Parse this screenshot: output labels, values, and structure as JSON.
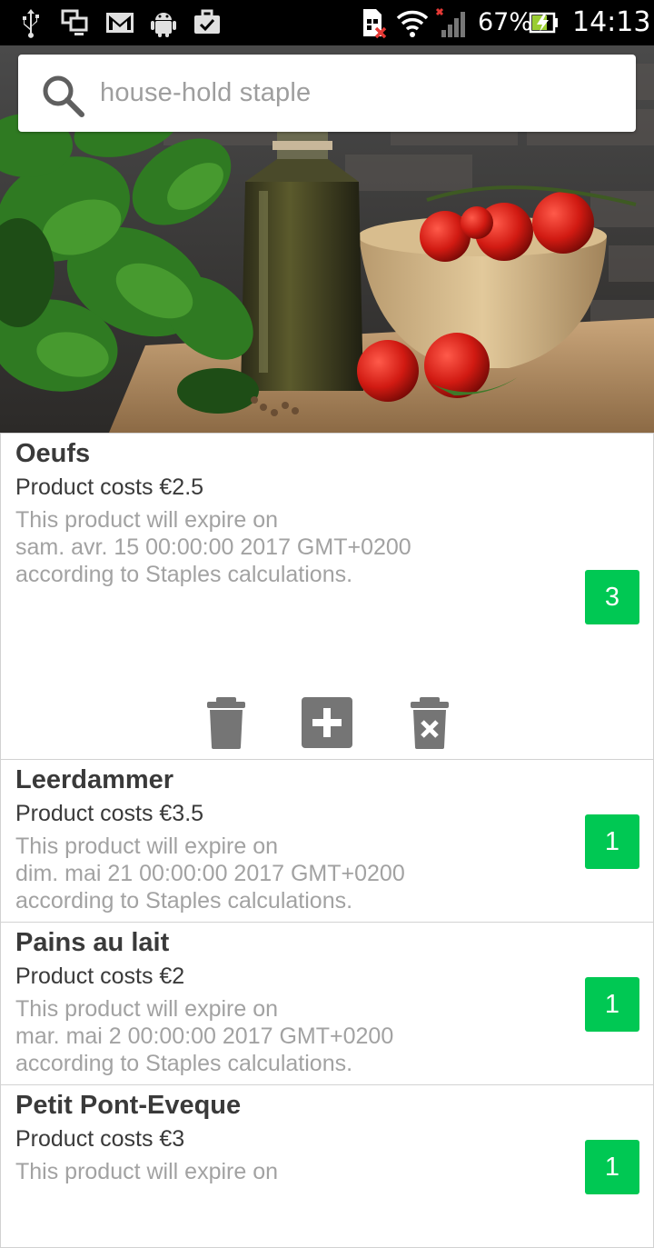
{
  "status_bar": {
    "battery": "67%",
    "time": "14:13",
    "icons": [
      "usb-icon",
      "screen-cast-icon",
      "gmail-icon",
      "android-icon",
      "briefcase-check-icon",
      "sim-error-icon",
      "wifi-icon",
      "signal-icon",
      "battery-charging-icon"
    ]
  },
  "search": {
    "placeholder": "house-hold staple"
  },
  "items": [
    {
      "name": "Oeufs",
      "cost": "Product costs €2.5",
      "expiry_line1": "This product will expire on",
      "expiry_line2": "sam. avr. 15 00:00:00 2017 GMT+0200",
      "expiry_line3": "according to Staples calculations.",
      "quantity": "3",
      "expanded": true
    },
    {
      "name": "Leerdammer",
      "cost": "Product costs €3.5",
      "expiry_line1": "This product will expire on",
      "expiry_line2": "dim. mai 21 00:00:00 2017 GMT+0200",
      "expiry_line3": "according to Staples calculations.",
      "quantity": "1",
      "expanded": false
    },
    {
      "name": "Pains au lait",
      "cost": "Product costs €2",
      "expiry_line1": "This product will expire on",
      "expiry_line2": "mar. mai 2 00:00:00 2017 GMT+0200",
      "expiry_line3": "according to Staples calculations.",
      "quantity": "1",
      "expanded": false
    },
    {
      "name": "Petit Pont-Eveque",
      "cost": "Product costs €3",
      "expiry_line1": "This product will expire on",
      "expiry_line2": "",
      "expiry_line3": "",
      "quantity": "1",
      "expanded": false
    }
  ],
  "actions": [
    "delete-icon",
    "add-icon",
    "delete-all-icon"
  ],
  "colors": {
    "accent_green": "#00c853",
    "action_grey": "#757575",
    "secondary_text": "#a2a2a2",
    "primary_text": "#3a3a3a"
  }
}
